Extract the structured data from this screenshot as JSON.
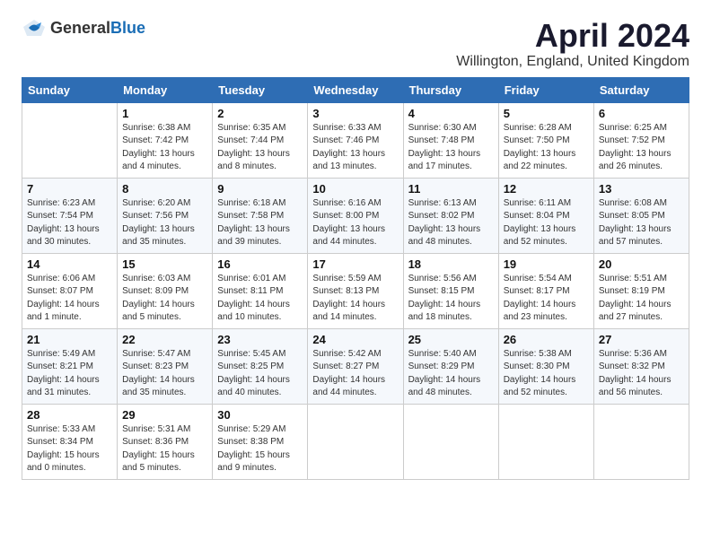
{
  "header": {
    "logo_general": "General",
    "logo_blue": "Blue",
    "month": "April 2024",
    "location": "Willington, England, United Kingdom"
  },
  "days_of_week": [
    "Sunday",
    "Monday",
    "Tuesday",
    "Wednesday",
    "Thursday",
    "Friday",
    "Saturday"
  ],
  "weeks": [
    [
      {
        "day": "",
        "content": ""
      },
      {
        "day": "1",
        "content": "Sunrise: 6:38 AM\nSunset: 7:42 PM\nDaylight: 13 hours\nand 4 minutes."
      },
      {
        "day": "2",
        "content": "Sunrise: 6:35 AM\nSunset: 7:44 PM\nDaylight: 13 hours\nand 8 minutes."
      },
      {
        "day": "3",
        "content": "Sunrise: 6:33 AM\nSunset: 7:46 PM\nDaylight: 13 hours\nand 13 minutes."
      },
      {
        "day": "4",
        "content": "Sunrise: 6:30 AM\nSunset: 7:48 PM\nDaylight: 13 hours\nand 17 minutes."
      },
      {
        "day": "5",
        "content": "Sunrise: 6:28 AM\nSunset: 7:50 PM\nDaylight: 13 hours\nand 22 minutes."
      },
      {
        "day": "6",
        "content": "Sunrise: 6:25 AM\nSunset: 7:52 PM\nDaylight: 13 hours\nand 26 minutes."
      }
    ],
    [
      {
        "day": "7",
        "content": "Sunrise: 6:23 AM\nSunset: 7:54 PM\nDaylight: 13 hours\nand 30 minutes."
      },
      {
        "day": "8",
        "content": "Sunrise: 6:20 AM\nSunset: 7:56 PM\nDaylight: 13 hours\nand 35 minutes."
      },
      {
        "day": "9",
        "content": "Sunrise: 6:18 AM\nSunset: 7:58 PM\nDaylight: 13 hours\nand 39 minutes."
      },
      {
        "day": "10",
        "content": "Sunrise: 6:16 AM\nSunset: 8:00 PM\nDaylight: 13 hours\nand 44 minutes."
      },
      {
        "day": "11",
        "content": "Sunrise: 6:13 AM\nSunset: 8:02 PM\nDaylight: 13 hours\nand 48 minutes."
      },
      {
        "day": "12",
        "content": "Sunrise: 6:11 AM\nSunset: 8:04 PM\nDaylight: 13 hours\nand 52 minutes."
      },
      {
        "day": "13",
        "content": "Sunrise: 6:08 AM\nSunset: 8:05 PM\nDaylight: 13 hours\nand 57 minutes."
      }
    ],
    [
      {
        "day": "14",
        "content": "Sunrise: 6:06 AM\nSunset: 8:07 PM\nDaylight: 14 hours\nand 1 minute."
      },
      {
        "day": "15",
        "content": "Sunrise: 6:03 AM\nSunset: 8:09 PM\nDaylight: 14 hours\nand 5 minutes."
      },
      {
        "day": "16",
        "content": "Sunrise: 6:01 AM\nSunset: 8:11 PM\nDaylight: 14 hours\nand 10 minutes."
      },
      {
        "day": "17",
        "content": "Sunrise: 5:59 AM\nSunset: 8:13 PM\nDaylight: 14 hours\nand 14 minutes."
      },
      {
        "day": "18",
        "content": "Sunrise: 5:56 AM\nSunset: 8:15 PM\nDaylight: 14 hours\nand 18 minutes."
      },
      {
        "day": "19",
        "content": "Sunrise: 5:54 AM\nSunset: 8:17 PM\nDaylight: 14 hours\nand 23 minutes."
      },
      {
        "day": "20",
        "content": "Sunrise: 5:51 AM\nSunset: 8:19 PM\nDaylight: 14 hours\nand 27 minutes."
      }
    ],
    [
      {
        "day": "21",
        "content": "Sunrise: 5:49 AM\nSunset: 8:21 PM\nDaylight: 14 hours\nand 31 minutes."
      },
      {
        "day": "22",
        "content": "Sunrise: 5:47 AM\nSunset: 8:23 PM\nDaylight: 14 hours\nand 35 minutes."
      },
      {
        "day": "23",
        "content": "Sunrise: 5:45 AM\nSunset: 8:25 PM\nDaylight: 14 hours\nand 40 minutes."
      },
      {
        "day": "24",
        "content": "Sunrise: 5:42 AM\nSunset: 8:27 PM\nDaylight: 14 hours\nand 44 minutes."
      },
      {
        "day": "25",
        "content": "Sunrise: 5:40 AM\nSunset: 8:29 PM\nDaylight: 14 hours\nand 48 minutes."
      },
      {
        "day": "26",
        "content": "Sunrise: 5:38 AM\nSunset: 8:30 PM\nDaylight: 14 hours\nand 52 minutes."
      },
      {
        "day": "27",
        "content": "Sunrise: 5:36 AM\nSunset: 8:32 PM\nDaylight: 14 hours\nand 56 minutes."
      }
    ],
    [
      {
        "day": "28",
        "content": "Sunrise: 5:33 AM\nSunset: 8:34 PM\nDaylight: 15 hours\nand 0 minutes."
      },
      {
        "day": "29",
        "content": "Sunrise: 5:31 AM\nSunset: 8:36 PM\nDaylight: 15 hours\nand 5 minutes."
      },
      {
        "day": "30",
        "content": "Sunrise: 5:29 AM\nSunset: 8:38 PM\nDaylight: 15 hours\nand 9 minutes."
      },
      {
        "day": "",
        "content": ""
      },
      {
        "day": "",
        "content": ""
      },
      {
        "day": "",
        "content": ""
      },
      {
        "day": "",
        "content": ""
      }
    ]
  ]
}
